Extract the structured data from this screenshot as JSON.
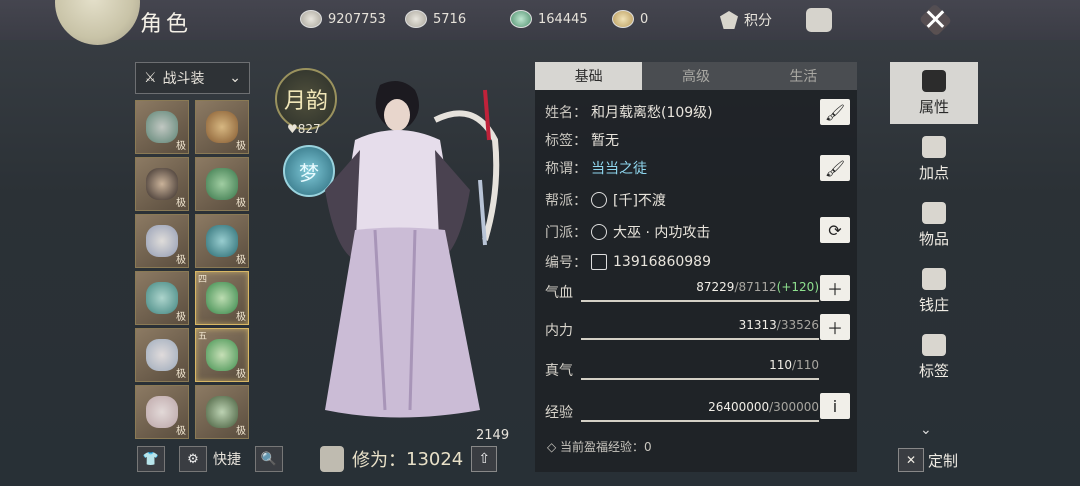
{
  "header": {
    "title": "角色",
    "currencies": [
      {
        "icon": "coin-reel-icon",
        "value": "9207753"
      },
      {
        "icon": "silver-ingot-icon",
        "value": "5716"
      },
      {
        "icon": "jade-ticket-icon",
        "value": "164445"
      },
      {
        "icon": "gold-ingot-icon",
        "value": "0"
      }
    ],
    "score_label": "积分",
    "close_label": "✕"
  },
  "equipment": {
    "outfit_label": "战斗装",
    "slots": [
      {
        "grade": "极",
        "num": ""
      },
      {
        "grade": "极",
        "num": ""
      },
      {
        "grade": "极",
        "num": ""
      },
      {
        "grade": "极",
        "num": ""
      },
      {
        "grade": "极",
        "num": ""
      },
      {
        "grade": "极",
        "num": ""
      },
      {
        "grade": "极",
        "num": ""
      },
      {
        "grade": "极",
        "num": "四"
      },
      {
        "grade": "极",
        "num": ""
      },
      {
        "grade": "极",
        "num": "五"
      },
      {
        "grade": "极",
        "num": ""
      },
      {
        "grade": "极",
        "num": ""
      }
    ],
    "shortcut_label": "快捷"
  },
  "character": {
    "emblem_text": "月韵",
    "emblem_value": "827",
    "emblem2_text": "梦",
    "power": "2149",
    "xiuwei_label": "修为：",
    "xiuwei_value": "13024"
  },
  "info": {
    "tabs": [
      "基础",
      "高级",
      "生活"
    ],
    "name_label": "姓名：",
    "name_value": "和月载离愁(109级)",
    "tag_label": "标签：",
    "tag_value": "暂无",
    "title_label": "称谓：",
    "title_value": "当当之徒",
    "guild_label": "帮派：",
    "guild_value": "[千]不渡",
    "school_label": "门派：",
    "school_value": "大巫 · 内功攻击",
    "id_label": "编号：",
    "id_value": "13916860989",
    "stats": [
      {
        "label": "气血",
        "current": "87229",
        "max": "/87112",
        "bonus": "(+120)"
      },
      {
        "label": "内力",
        "current": "31313",
        "max": "/33526",
        "bonus": ""
      },
      {
        "label": "真气",
        "current": "110",
        "max": "/110",
        "bonus": ""
      },
      {
        "label": "经验",
        "current": "26400000",
        "max": "/300000",
        "bonus": ""
      }
    ],
    "exp_note": "◇ 当前盈福经验：0"
  },
  "sidebar": {
    "items": [
      {
        "label": "属性",
        "icon": "scholar-hat-icon"
      },
      {
        "label": "加点",
        "icon": "sliders-icon"
      },
      {
        "label": "物品",
        "icon": "bag-icon"
      },
      {
        "label": "钱庄",
        "icon": "money-bag-icon"
      },
      {
        "label": "标签",
        "icon": "tag-icon"
      }
    ],
    "custom_label": "定制"
  }
}
